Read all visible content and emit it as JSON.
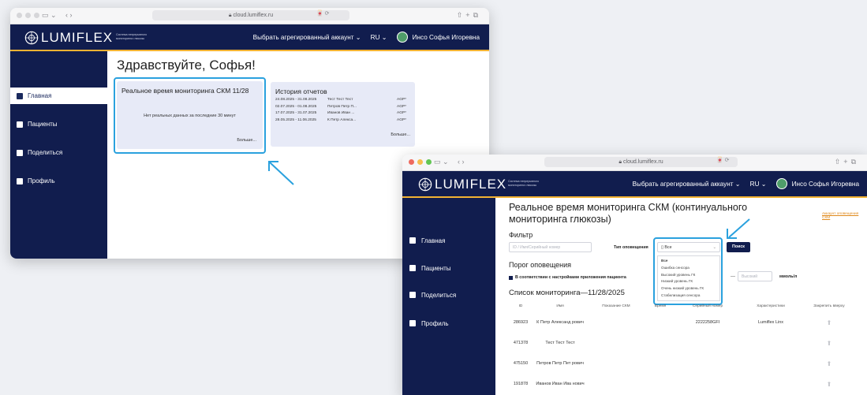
{
  "colors": {
    "navy": "#111d4e",
    "gold": "#f2b233",
    "highlight": "#2aa1de",
    "card": "#e7eaf7"
  },
  "browser": {
    "url": "cloud.lumiflex.ru",
    "ext": "🀄 ⟳"
  },
  "brand": {
    "logo": "LUMIFLEX",
    "tagline": "Система непрерывного мониторинга глюкозы"
  },
  "header": {
    "account": "Выбрать агрегированный аккаунт",
    "lang": "RU",
    "user": "Инсо Софья Игоревна"
  },
  "sidebar": {
    "items": [
      {
        "label": "Главная",
        "icon": "home-icon"
      },
      {
        "label": "Пациенты",
        "icon": "patients-icon"
      },
      {
        "label": "Поделиться",
        "icon": "share-icon"
      },
      {
        "label": "Профиль",
        "icon": "profile-icon"
      }
    ]
  },
  "home": {
    "greeting": "Здравствуйте, Софья!",
    "rt_card": {
      "title": "Реальное время мониторинга СКМ 11/28",
      "empty": "Нет реальных данных за последние 30 минут",
      "more": "Больше..."
    },
    "history": {
      "title": "История отчетов",
      "more": "Больше...",
      "rows": [
        {
          "dates": "24.08.2025 - 31.08.2025",
          "name": "Тест Тест Тест",
          "type": "AGP*"
        },
        {
          "dates": "02.07.2025 - 01.08.2025",
          "name": "Петров Петр П...",
          "type": "AGP*"
        },
        {
          "dates": "17.07.2025 - 31.07.2025",
          "name": "Иванов Иван ...",
          "type": "AGP*"
        },
        {
          "dates": "28.05.2025 - 11.06.2025",
          "name": "К Петр Алекса...",
          "type": "AGP*"
        }
      ]
    }
  },
  "rt": {
    "title": "Реальное время мониторинга СКМ (континуального мониторинга глюкозы)",
    "alert_link": "Аккаунт оповещения СКМ",
    "filter_label": "Фильтр",
    "search_placeholder": "ID / Имя/Серийный номер",
    "alert_type_label": "Тип оповещения",
    "select_value": "Все",
    "options": [
      "Все",
      "Ошибка сенсора",
      "Высокий уровень ГК",
      "Низкий уровень ГК",
      "Очень низкий уровень ГК",
      "Стабилизация сенсора"
    ],
    "search_button": "Поиск",
    "threshold_title": "Порог оповещения",
    "threshold_check": "В соответствии с настройками приложения пациента",
    "dash": "—",
    "high_placeholder": "Высокий",
    "unit": "ммоль/л",
    "list_title": "Список мониторинга—11/28/2025",
    "columns": [
      "ID",
      "Имя",
      "Показание СКМ",
      "Время",
      "Серийный номер",
      "Характеристики",
      "Закрепить вверху"
    ],
    "rows": [
      {
        "id": "286923",
        "name": "К Петр Александ рович",
        "reading": "",
        "time": "",
        "serial": "2222258GFI",
        "device": "Lumiflex Linx"
      },
      {
        "id": "471378",
        "name": "Тест Тест Тест",
        "reading": "",
        "time": "",
        "serial": "",
        "device": ""
      },
      {
        "id": "475150",
        "name": "Петров Петр Пет рович",
        "reading": "",
        "time": "",
        "serial": "",
        "device": ""
      },
      {
        "id": "191878",
        "name": "Иванов Иван Ива нович",
        "reading": "",
        "time": "",
        "serial": "",
        "device": ""
      }
    ]
  }
}
